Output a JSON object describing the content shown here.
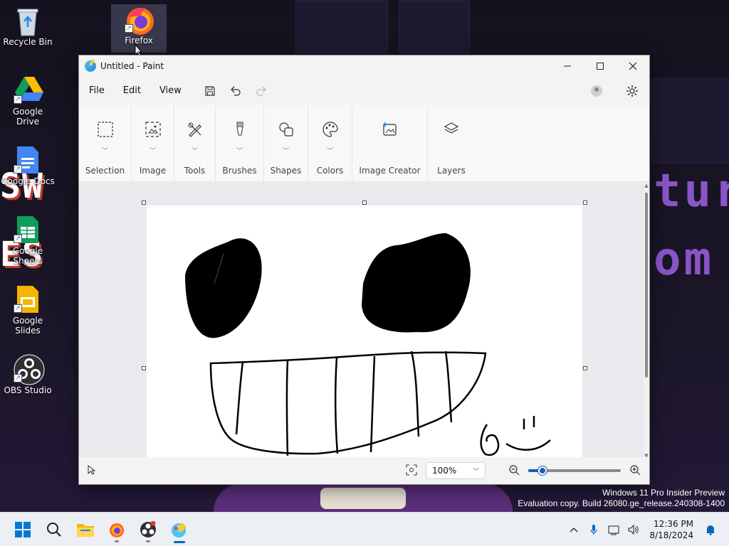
{
  "desktop": {
    "icons": [
      {
        "label": "Recycle Bin"
      },
      {
        "label": "Firefox"
      },
      {
        "label": "Google Drive"
      },
      {
        "label": "Google Docs"
      },
      {
        "label": "Google Sheets"
      },
      {
        "label": "Google Slides"
      },
      {
        "label": "OBS Studio"
      }
    ]
  },
  "window": {
    "title": "Untitled - Paint",
    "menu": {
      "file": "File",
      "edit": "Edit",
      "view": "View"
    },
    "ribbon": {
      "groups": [
        "Selection",
        "Image",
        "Tools",
        "Brushes",
        "Shapes",
        "Colors",
        "Image Creator",
        "Layers"
      ]
    },
    "status": {
      "zoom": "100%",
      "zoom_level_percent": 100
    }
  },
  "watermark": {
    "line1": "Windows 11 Pro Insider Preview",
    "line2": "Evaluation copy. Build 26080.ge_release.240308-1400"
  },
  "taskbar": {
    "clock_time": "12:36 PM",
    "clock_date": "8/18/2024"
  },
  "colors": {
    "accent": "#0067c0",
    "slider": "#1a5fb4",
    "wallpaper_text": "#8a55c7"
  }
}
